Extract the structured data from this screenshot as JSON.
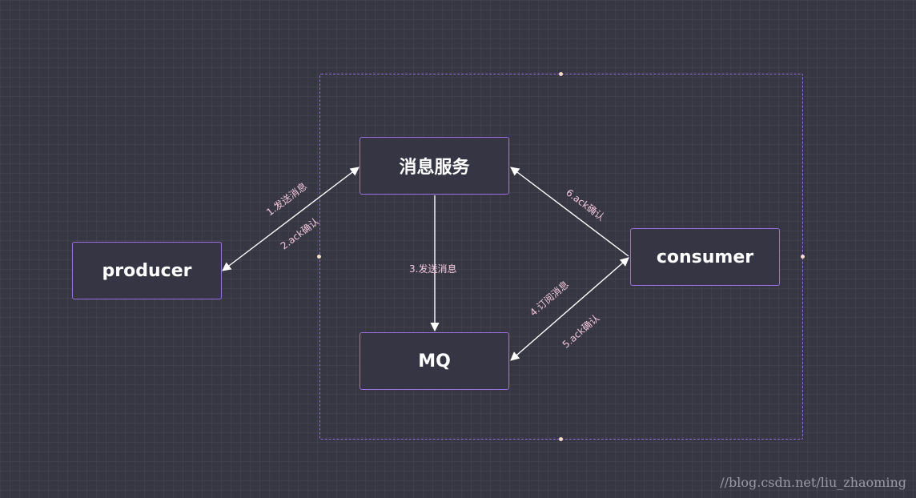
{
  "diagram": {
    "nodes": {
      "producer": "producer",
      "message_service": "消息服务",
      "mq": "MQ",
      "consumer": "consumer"
    },
    "edges": {
      "send_to_service": "1.发送消息",
      "ack_to_producer": "2.ack确认",
      "service_to_mq": "3.发送消息",
      "subscribe": "4.订阅消息",
      "ack_to_mq": "5.ack确认",
      "ack_to_service": "6.ack确认"
    }
  },
  "watermark": "//blog.csdn.net/liu_zhaoming",
  "colors": {
    "background": "#373744",
    "node_border": "#9c6fe0",
    "edge": "#ffffff",
    "edge_label": "#f3c7dc"
  }
}
